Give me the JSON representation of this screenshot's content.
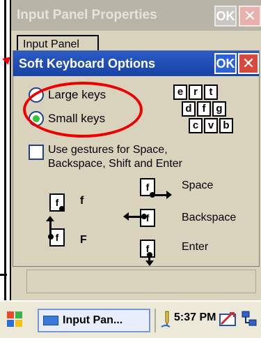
{
  "background_window": {
    "title": "Input Panel Properties",
    "ok_label": "OK",
    "close_label": "✕",
    "tab_label": "Input Panel"
  },
  "dialog": {
    "title": "Soft Keyboard Options",
    "ok_label": "OK",
    "close_label": "✕",
    "radio_large_label": "Large keys",
    "radio_small_label": "Small keys",
    "selected_option": "Small keys",
    "sample_keys_row1": [
      "e",
      "r",
      "t"
    ],
    "sample_keys_row2": [
      "d",
      "f",
      "g"
    ],
    "sample_keys_row3": [
      "c",
      "v",
      "b"
    ],
    "gestures_checkbox_label": "Use gestures for Space, Backspace, Shift and Enter",
    "gestures_checked": false,
    "gesture_letter": "f",
    "gesture_shift_letter": "f",
    "gesture_lower_label": "f",
    "gesture_upper_label": "F",
    "gesture_space_label": "Space",
    "gesture_backspace_label": "Backspace",
    "gesture_enter_label": "Enter"
  },
  "taskbar": {
    "task_label": "Input Pan...",
    "clock": "5:37 PM"
  },
  "colors": {
    "titlebar_active": "#1e4fb8",
    "dialog_bg": "#d9d3bd",
    "annotation_red": "#e00000",
    "radio_selected": "#2ec63a"
  },
  "icons": [
    "windows-start-icon",
    "keyboard-icon",
    "stylus-icon",
    "keyboard-tray-icon",
    "network-icon",
    "close-icon"
  ]
}
